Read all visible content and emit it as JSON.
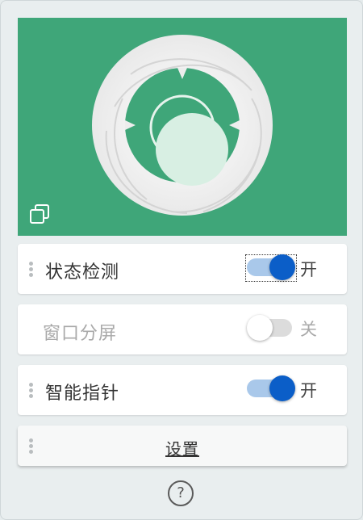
{
  "preview": {
    "background_color": "#3fa679",
    "icon": "window-restore-icon"
  },
  "rows": [
    {
      "label": "状态检测",
      "state": "开",
      "enabled": true,
      "on": true
    },
    {
      "label": "窗口分屏",
      "state": "关",
      "enabled": false,
      "on": false
    },
    {
      "label": "智能指针",
      "state": "开",
      "enabled": true,
      "on": true
    }
  ],
  "settings_label": "设置",
  "help_label": "?",
  "colors": {
    "toggle_on_knob": "#0b5ec8",
    "toggle_on_track": "#a9c8ea",
    "toggle_off_track": "#dcdcdc"
  }
}
